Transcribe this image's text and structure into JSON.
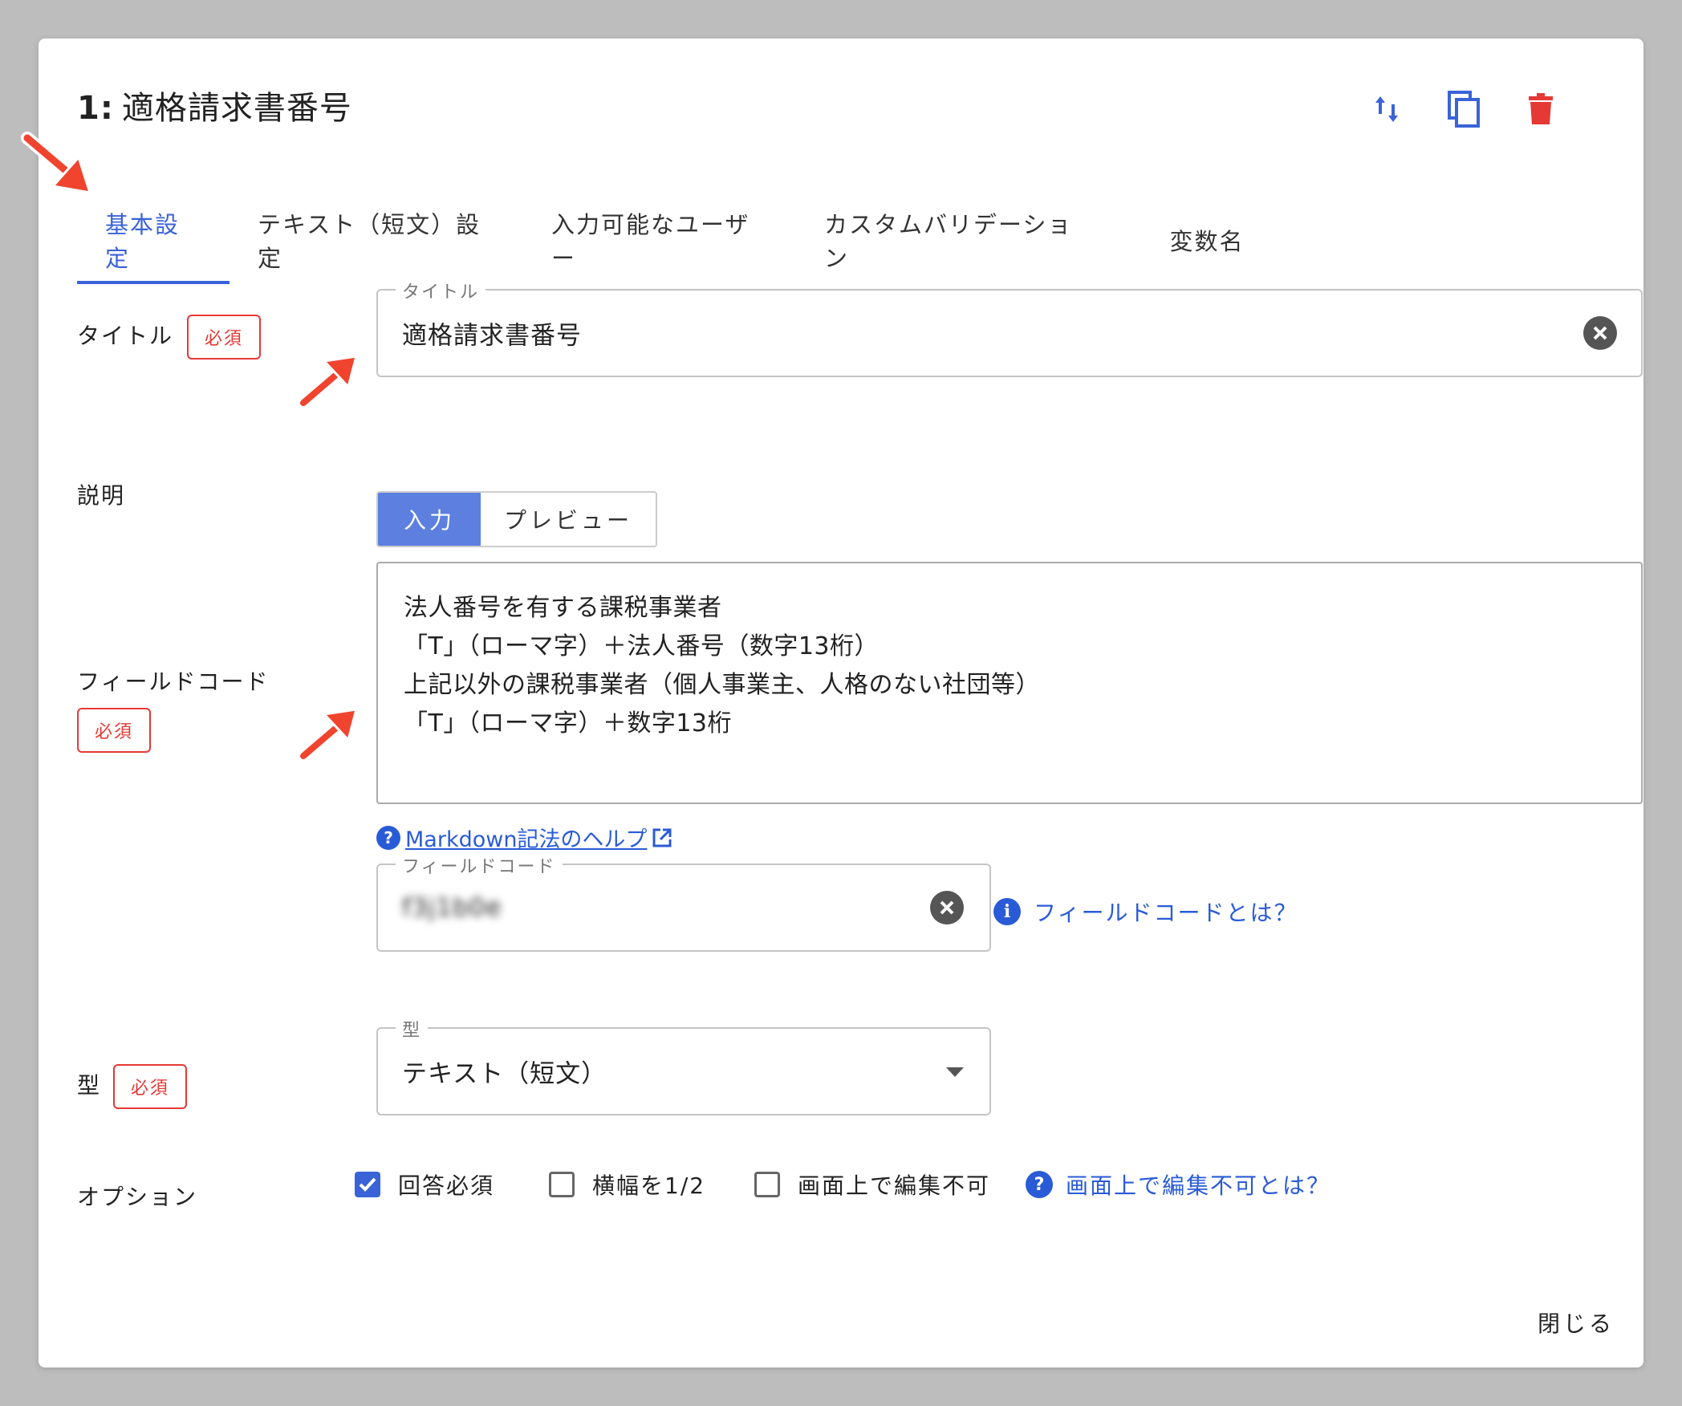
{
  "header": {
    "num": "1:",
    "title": "適格請求書番号"
  },
  "actions": [
    "sort-icon",
    "copy-icon",
    "delete-icon"
  ],
  "tabs": [
    "基本設定",
    "テキスト（短文）設定",
    "入力可能なユーザー",
    "カスタムバリデーション",
    "変数名"
  ],
  "required_badge": "必須",
  "title_field": {
    "label": "タイトル",
    "legend": "タイトル",
    "value": "適格請求書番号"
  },
  "description": {
    "label": "説明",
    "mode_input": "入力",
    "mode_preview": "プレビュー",
    "lines": [
      "法人番号を有する課税事業者",
      "「T」（ローマ字）＋法人番号（数字13桁）",
      "上記以外の課税事業者（個人事業主、人格のない社団等）",
      "「T」（ローマ字）＋数字13桁"
    ],
    "help_link": "Markdown記法のヘルプ"
  },
  "field_code": {
    "label": "フィールドコード",
    "legend": "フィールドコード",
    "value": "f3j1b0e",
    "help": "フィールドコードとは？"
  },
  "type": {
    "label": "型",
    "legend": "型",
    "value": "テキスト（短文）"
  },
  "options": {
    "label": "オプション",
    "items": [
      {
        "label": "回答必須",
        "checked": true
      },
      {
        "label": "横幅を1/2",
        "checked": false
      },
      {
        "label": "画面上で編集不可",
        "checked": false
      }
    ],
    "help": "画面上で編集不可とは？"
  },
  "close_label": "閉じる",
  "colors": {
    "accent": "#3a63d8",
    "required": "#e53935",
    "delete": "#e53935",
    "annotation_arrow": "#f0442f"
  }
}
